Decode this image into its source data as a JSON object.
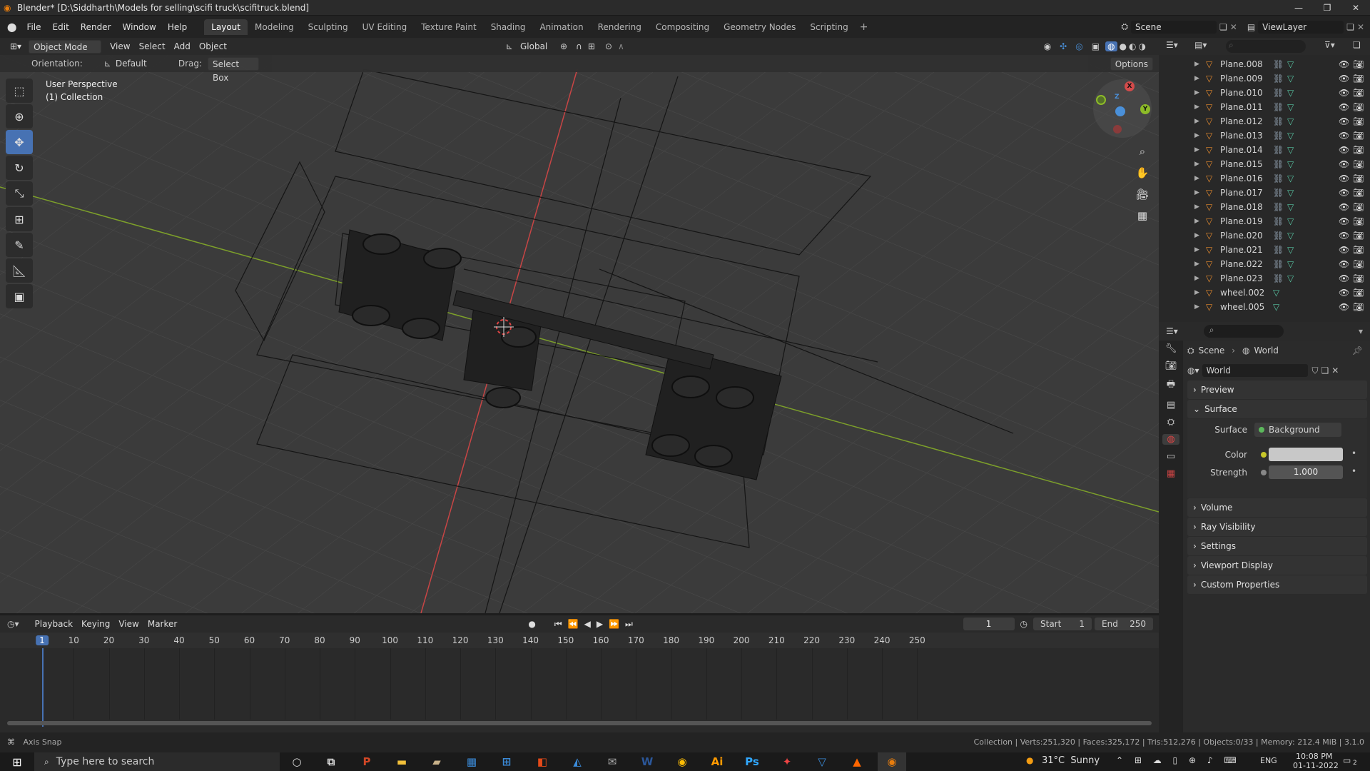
{
  "window": {
    "title": "Blender* [D:\\Siddharth\\Models for selling\\scifi truck\\scifitruck.blend]"
  },
  "menu": [
    "File",
    "Edit",
    "Render",
    "Window",
    "Help"
  ],
  "workspaces": [
    "Layout",
    "Modeling",
    "Sculpting",
    "UV Editing",
    "Texture Paint",
    "Shading",
    "Animation",
    "Rendering",
    "Compositing",
    "Geometry Nodes",
    "Scripting"
  ],
  "active_workspace": "Layout",
  "scene": {
    "name": "Scene",
    "view_layer": "ViewLayer"
  },
  "viewport_header": {
    "mode": "Object Mode",
    "menus": [
      "View",
      "Select",
      "Add",
      "Object"
    ],
    "transform_orientation": "Global",
    "options_label": "Options"
  },
  "tool_settings": {
    "orientation_label": "Orientation:",
    "orientation_value": "Default",
    "drag_label": "Drag:",
    "drag_value": "Select Box"
  },
  "viewport": {
    "perspective": "User Perspective",
    "collection": "(1) Collection"
  },
  "gizmo_axes": {
    "x": "X",
    "y": "Y",
    "z": "Z"
  },
  "outliner": {
    "items": [
      "Plane.008",
      "Plane.009",
      "Plane.010",
      "Plane.011",
      "Plane.012",
      "Plane.013",
      "Plane.014",
      "Plane.015",
      "Plane.016",
      "Plane.017",
      "Plane.018",
      "Plane.019",
      "Plane.020",
      "Plane.021",
      "Plane.022",
      "Plane.023",
      "wheel.002",
      "wheel.005"
    ]
  },
  "properties": {
    "breadcrumb_scene": "Scene",
    "breadcrumb_world": "World",
    "world_name": "World",
    "sections": {
      "preview": "Preview",
      "surface": "Surface",
      "volume": "Volume",
      "ray_visibility": "Ray Visibility",
      "settings": "Settings",
      "viewport_display": "Viewport Display",
      "custom_properties": "Custom Properties"
    },
    "surface_label": "Surface",
    "surface_value": "Background",
    "color_label": "Color",
    "color_value": "#c8c8c8",
    "strength_label": "Strength",
    "strength_value": "1.000"
  },
  "timeline": {
    "menus": [
      "Playback",
      "Keying",
      "View",
      "Marker"
    ],
    "current_frame": "1",
    "start_label": "Start",
    "start": "1",
    "end_label": "End",
    "end": "250",
    "ruler": [
      "1",
      "10",
      "20",
      "30",
      "40",
      "50",
      "60",
      "70",
      "80",
      "90",
      "100",
      "110",
      "120",
      "130",
      "140",
      "150",
      "160",
      "170",
      "180",
      "190",
      "200",
      "210",
      "220",
      "230",
      "240",
      "250"
    ]
  },
  "status": {
    "left": "Axis Snap",
    "right": "Collection | Verts:251,320 | Faces:325,172 | Tris:512,276 | Objects:0/33 | Memory: 212.4 MiB | 3.1.0"
  },
  "taskbar": {
    "search_placeholder": "Type here to search",
    "weather": "31°C  Sunny",
    "language": "ENG",
    "time": "10:08 PM",
    "date": "01-11-2022",
    "notification_count": "2"
  },
  "colors": {
    "accent": "#4772b3",
    "x_axis": "#d34b4b",
    "y_axis": "#8dbb28",
    "z_axis": "#4a90d9",
    "object_icon": "#e58a2e",
    "mesh_icon": "#58c4a2"
  }
}
